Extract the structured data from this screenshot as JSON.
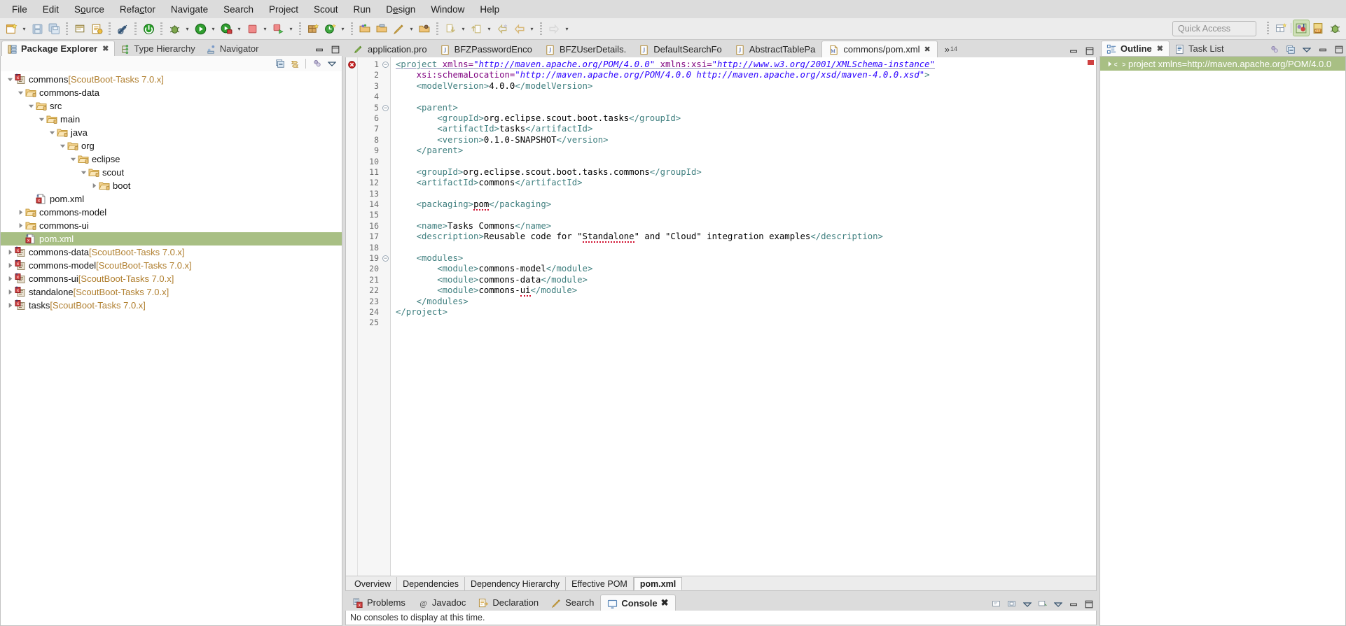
{
  "menubar": {
    "items": [
      {
        "label": "File"
      },
      {
        "label": "Edit"
      },
      {
        "label": "Source"
      },
      {
        "label": "Refactor"
      },
      {
        "label": "Navigate"
      },
      {
        "label": "Search"
      },
      {
        "label": "Project"
      },
      {
        "label": "Scout"
      },
      {
        "label": "Run"
      },
      {
        "label": "Design"
      },
      {
        "label": "Window"
      },
      {
        "label": "Help"
      }
    ]
  },
  "toolbar": {
    "quick_access_placeholder": "Quick Access",
    "buttons": [
      {
        "name": "new-wizard",
        "icon": "new-file-icon"
      },
      {
        "name": "save",
        "icon": "save-icon"
      },
      {
        "name": "save-all",
        "icon": "save-all-icon"
      },
      {
        "name": "print",
        "icon": "print-icon"
      },
      {
        "name": "new-java-package",
        "icon": "package-icon"
      },
      {
        "name": "toggle-mark-occurrences",
        "icon": "mark-occurrences-icon"
      },
      {
        "name": "skip-breakpoints",
        "icon": "skip-breakpoints-icon"
      },
      {
        "name": "debug",
        "icon": "debug-icon"
      },
      {
        "name": "run",
        "icon": "run-icon"
      },
      {
        "name": "coverage",
        "icon": "coverage-icon"
      },
      {
        "name": "terminate",
        "icon": "terminate-icon"
      },
      {
        "name": "run-external-tools",
        "icon": "external-tools-icon"
      },
      {
        "name": "new-scout-project",
        "icon": "scout-project-icon"
      },
      {
        "name": "new-scout-element",
        "icon": "scout-element-icon"
      },
      {
        "name": "open-type",
        "icon": "open-type-icon"
      },
      {
        "name": "open-task",
        "icon": "open-task-icon"
      },
      {
        "name": "search",
        "icon": "search-pen-icon"
      },
      {
        "name": "open-resource",
        "icon": "open-resource-icon"
      },
      {
        "name": "next-annotation",
        "icon": "next-annotation-icon"
      },
      {
        "name": "previous-annotation",
        "icon": "previous-annotation-icon"
      },
      {
        "name": "last-edit-location",
        "icon": "last-edit-icon"
      },
      {
        "name": "back",
        "icon": "back-arrow-icon"
      },
      {
        "name": "forward",
        "icon": "forward-arrow-icon"
      },
      {
        "name": "pin-editor",
        "icon": "pin-icon"
      }
    ],
    "right_buttons": [
      {
        "name": "open-perspective",
        "icon": "open-perspective-icon"
      },
      {
        "name": "perspective-java-ee",
        "icon": "java-ee-perspective-icon",
        "active": true
      },
      {
        "name": "perspective-git",
        "icon": "git-perspective-icon"
      },
      {
        "name": "perspective-debug",
        "icon": "debug-perspective-icon"
      }
    ]
  },
  "package_explorer": {
    "tabs": [
      {
        "label": "Package Explorer",
        "icon": "package-explorer-icon",
        "active": true,
        "closeable": true
      },
      {
        "label": "Type Hierarchy",
        "icon": "type-hierarchy-icon",
        "active": false,
        "closeable": false
      },
      {
        "label": "Navigator",
        "icon": "navigator-icon",
        "active": false,
        "closeable": false
      }
    ],
    "view_toolbar": [
      {
        "name": "collapse-all",
        "icon": "collapse-all-icon"
      },
      {
        "name": "link-with-editor",
        "icon": "link-editor-icon"
      },
      {
        "name": "focus-on-active-task",
        "icon": "focus-task-icon"
      },
      {
        "name": "view-menu",
        "icon": "view-menu-icon"
      }
    ],
    "tree": [
      {
        "depth": 0,
        "twist": "down",
        "icon": "maven-project-icon",
        "label": "commons",
        "suffix": " [ScoutBoot-Tasks 7.0.x]",
        "selected": false
      },
      {
        "depth": 1,
        "twist": "down",
        "icon": "folder-icon",
        "label": "commons-data",
        "suffix": "",
        "selected": false
      },
      {
        "depth": 2,
        "twist": "down",
        "icon": "folder-icon",
        "label": "src",
        "suffix": "",
        "selected": false
      },
      {
        "depth": 3,
        "twist": "down",
        "icon": "folder-icon",
        "label": "main",
        "suffix": "",
        "selected": false
      },
      {
        "depth": 4,
        "twist": "down",
        "icon": "folder-icon",
        "label": "java",
        "suffix": "",
        "selected": false
      },
      {
        "depth": 5,
        "twist": "down",
        "icon": "folder-icon",
        "label": "org",
        "suffix": "",
        "selected": false
      },
      {
        "depth": 6,
        "twist": "down",
        "icon": "folder-icon",
        "label": "eclipse",
        "suffix": "",
        "selected": false
      },
      {
        "depth": 7,
        "twist": "down",
        "icon": "folder-icon",
        "label": "scout",
        "suffix": "",
        "selected": false
      },
      {
        "depth": 8,
        "twist": "right",
        "icon": "folder-icon",
        "label": "boot",
        "suffix": "",
        "selected": false
      },
      {
        "depth": 2,
        "twist": "none",
        "icon": "pom-file-icon",
        "label": "pom.xml",
        "suffix": "",
        "selected": false
      },
      {
        "depth": 1,
        "twist": "right",
        "icon": "folder-icon",
        "label": "commons-model",
        "suffix": "",
        "selected": false
      },
      {
        "depth": 1,
        "twist": "right",
        "icon": "folder-icon",
        "label": "commons-ui",
        "suffix": "",
        "selected": false
      },
      {
        "depth": 1,
        "twist": "none",
        "icon": "pom-file-icon",
        "label": "pom.xml",
        "suffix": "",
        "selected": true
      },
      {
        "depth": 0,
        "twist": "right",
        "icon": "maven-project-icon",
        "label": "commons-data",
        "suffix": " [ScoutBoot-Tasks 7.0.x]",
        "selected": false
      },
      {
        "depth": 0,
        "twist": "right",
        "icon": "maven-project-icon",
        "label": "commons-model",
        "suffix": " [ScoutBoot-Tasks 7.0.x]",
        "selected": false
      },
      {
        "depth": 0,
        "twist": "right",
        "icon": "maven-project-icon",
        "label": "commons-ui",
        "suffix": " [ScoutBoot-Tasks 7.0.x]",
        "selected": false
      },
      {
        "depth": 0,
        "twist": "right",
        "icon": "maven-project-icon",
        "label": "standalone",
        "suffix": " [ScoutBoot-Tasks 7.0.x]",
        "selected": false
      },
      {
        "depth": 0,
        "twist": "right",
        "icon": "maven-project-icon",
        "label": "tasks",
        "suffix": " [ScoutBoot-Tasks 7.0.x]",
        "selected": false
      }
    ]
  },
  "editor": {
    "tabs": [
      {
        "label": "application.pro",
        "icon": "properties-file-icon",
        "active": false
      },
      {
        "label": "BFZPasswordEnco",
        "icon": "java-file-icon",
        "active": false
      },
      {
        "label": "BFZUserDetails.",
        "icon": "java-file-icon",
        "active": false
      },
      {
        "label": "DefaultSearchFo",
        "icon": "java-file-icon",
        "active": false
      },
      {
        "label": "AbstractTablePa",
        "icon": "java-file-icon",
        "active": false
      },
      {
        "label": "commons/pom.xml",
        "icon": "maven-file-icon",
        "active": true
      }
    ],
    "hidden_tabs_count": "14",
    "hidden_tabs_chevron": "»",
    "lines": [
      {
        "num": "1",
        "fold": "minus",
        "error": true,
        "segments": [
          {
            "t": "<project ",
            "c": "tag"
          },
          {
            "t": "xmlns=",
            "c": "attn"
          },
          {
            "t": "\"http://maven.apache.org/POM/4.0.0\"",
            "c": "attv"
          },
          {
            "t": " ",
            "c": "txt"
          },
          {
            "t": "xmlns:xsi=",
            "c": "attn"
          },
          {
            "t": "\"http://www.w3.org/2001/XMLSchema-instance\"",
            "c": "attv"
          }
        ]
      },
      {
        "num": "2",
        "fold": "",
        "error": false,
        "segments": [
          {
            "t": "    ",
            "c": "txt"
          },
          {
            "t": "xsi:schemaLocation=",
            "c": "attn"
          },
          {
            "t": "\"http://maven.apache.org/POM/4.0.0 http://maven.apache.org/xsd/maven-4.0.0.xsd\"",
            "c": "attv"
          },
          {
            "t": ">",
            "c": "tag"
          }
        ]
      },
      {
        "num": "3",
        "fold": "",
        "error": false,
        "segments": [
          {
            "t": "    ",
            "c": "txt"
          },
          {
            "t": "<modelVersion>",
            "c": "tag"
          },
          {
            "t": "4.0.0",
            "c": "txt"
          },
          {
            "t": "</modelVersion>",
            "c": "tag"
          }
        ]
      },
      {
        "num": "4",
        "fold": "",
        "error": false,
        "segments": []
      },
      {
        "num": "5",
        "fold": "minus",
        "error": false,
        "segments": [
          {
            "t": "    ",
            "c": "txt"
          },
          {
            "t": "<parent>",
            "c": "tag"
          }
        ]
      },
      {
        "num": "6",
        "fold": "",
        "error": false,
        "segments": [
          {
            "t": "        ",
            "c": "txt"
          },
          {
            "t": "<groupId>",
            "c": "tag"
          },
          {
            "t": "org.eclipse.scout.boot.tasks",
            "c": "txt"
          },
          {
            "t": "</groupId>",
            "c": "tag"
          }
        ]
      },
      {
        "num": "7",
        "fold": "",
        "error": false,
        "segments": [
          {
            "t": "        ",
            "c": "txt"
          },
          {
            "t": "<artifactId>",
            "c": "tag"
          },
          {
            "t": "tasks",
            "c": "txt"
          },
          {
            "t": "</artifactId>",
            "c": "tag"
          }
        ]
      },
      {
        "num": "8",
        "fold": "",
        "error": false,
        "segments": [
          {
            "t": "        ",
            "c": "txt"
          },
          {
            "t": "<version>",
            "c": "tag"
          },
          {
            "t": "0.1.0-SNAPSHOT",
            "c": "txt"
          },
          {
            "t": "</version>",
            "c": "tag"
          }
        ]
      },
      {
        "num": "9",
        "fold": "",
        "error": false,
        "segments": [
          {
            "t": "    ",
            "c": "txt"
          },
          {
            "t": "</parent>",
            "c": "tag"
          }
        ]
      },
      {
        "num": "10",
        "fold": "",
        "error": false,
        "segments": []
      },
      {
        "num": "11",
        "fold": "",
        "error": false,
        "segments": [
          {
            "t": "    ",
            "c": "txt"
          },
          {
            "t": "<groupId>",
            "c": "tag"
          },
          {
            "t": "org.eclipse.scout.boot.tasks.commons",
            "c": "txt"
          },
          {
            "t": "</groupId>",
            "c": "tag"
          }
        ]
      },
      {
        "num": "12",
        "fold": "",
        "error": false,
        "segments": [
          {
            "t": "    ",
            "c": "txt"
          },
          {
            "t": "<artifactId>",
            "c": "tag"
          },
          {
            "t": "commons",
            "c": "txt"
          },
          {
            "t": "</artifactId>",
            "c": "tag"
          }
        ]
      },
      {
        "num": "13",
        "fold": "",
        "error": false,
        "segments": []
      },
      {
        "num": "14",
        "fold": "",
        "error": false,
        "segments": [
          {
            "t": "    ",
            "c": "txt"
          },
          {
            "t": "<packaging>",
            "c": "tag"
          },
          {
            "t": "pom",
            "c": "squig"
          },
          {
            "t": "</packaging>",
            "c": "tag"
          }
        ]
      },
      {
        "num": "15",
        "fold": "",
        "error": false,
        "segments": []
      },
      {
        "num": "16",
        "fold": "",
        "error": false,
        "segments": [
          {
            "t": "    ",
            "c": "txt"
          },
          {
            "t": "<name>",
            "c": "tag"
          },
          {
            "t": "Tasks Commons",
            "c": "txt"
          },
          {
            "t": "</name>",
            "c": "tag"
          }
        ]
      },
      {
        "num": "17",
        "fold": "",
        "error": false,
        "segments": [
          {
            "t": "    ",
            "c": "txt"
          },
          {
            "t": "<description>",
            "c": "tag"
          },
          {
            "t": "Reusable code for \"",
            "c": "txt"
          },
          {
            "t": "Standalone",
            "c": "squig"
          },
          {
            "t": "\" and \"Cloud\" integration examples",
            "c": "txt"
          },
          {
            "t": "</description>",
            "c": "tag"
          }
        ]
      },
      {
        "num": "18",
        "fold": "",
        "error": false,
        "segments": []
      },
      {
        "num": "19",
        "fold": "minus",
        "error": false,
        "segments": [
          {
            "t": "    ",
            "c": "txt"
          },
          {
            "t": "<modules>",
            "c": "tag"
          }
        ]
      },
      {
        "num": "20",
        "fold": "",
        "error": false,
        "segments": [
          {
            "t": "        ",
            "c": "txt"
          },
          {
            "t": "<module>",
            "c": "tag"
          },
          {
            "t": "commons-model",
            "c": "txt"
          },
          {
            "t": "</module>",
            "c": "tag"
          }
        ]
      },
      {
        "num": "21",
        "fold": "",
        "error": false,
        "segments": [
          {
            "t": "        ",
            "c": "txt"
          },
          {
            "t": "<module>",
            "c": "tag"
          },
          {
            "t": "commons-data",
            "c": "txt"
          },
          {
            "t": "</module>",
            "c": "tag"
          }
        ]
      },
      {
        "num": "22",
        "fold": "",
        "error": false,
        "segments": [
          {
            "t": "        ",
            "c": "txt"
          },
          {
            "t": "<module>",
            "c": "tag"
          },
          {
            "t": "commons-",
            "c": "txt"
          },
          {
            "t": "ui",
            "c": "squig"
          },
          {
            "t": "</module>",
            "c": "tag"
          }
        ]
      },
      {
        "num": "23",
        "fold": "",
        "error": false,
        "segments": [
          {
            "t": "    ",
            "c": "txt"
          },
          {
            "t": "</modules>",
            "c": "tag"
          }
        ]
      },
      {
        "num": "24",
        "fold": "",
        "error": false,
        "segments": [
          {
            "t": "</project>",
            "c": "tag"
          }
        ]
      },
      {
        "num": "25",
        "fold": "",
        "error": false,
        "segments": []
      }
    ],
    "form_tabs": [
      {
        "label": "Overview",
        "active": false
      },
      {
        "label": "Dependencies",
        "active": false
      },
      {
        "label": "Dependency Hierarchy",
        "active": false
      },
      {
        "label": "Effective POM",
        "active": false
      },
      {
        "label": "pom.xml",
        "active": true
      }
    ]
  },
  "outline": {
    "tabs": [
      {
        "label": "Outline",
        "icon": "outline-icon",
        "active": true,
        "closeable": true
      },
      {
        "label": "Task List",
        "icon": "task-list-icon",
        "active": false,
        "closeable": false
      }
    ],
    "view_toolbar": [
      {
        "name": "focus-on-active-task",
        "icon": "focus-task-icon"
      },
      {
        "name": "collapse-all",
        "icon": "collapse-all-icon"
      },
      {
        "name": "view-menu",
        "icon": "view-menu-icon"
      },
      {
        "name": "minimize",
        "icon": "minimize-icon"
      },
      {
        "name": "maximize",
        "icon": "maximize-icon"
      }
    ],
    "tree": [
      {
        "twist": "right",
        "icon": "xml-element-icon",
        "label": "project xmlns=http://maven.apache.org/POM/4.0.0",
        "selected": true
      }
    ]
  },
  "bottom_panel": {
    "tabs": [
      {
        "label": "Problems",
        "icon": "problems-icon",
        "active": false,
        "closeable": false
      },
      {
        "label": "Javadoc",
        "icon": "javadoc-icon",
        "active": false,
        "closeable": false
      },
      {
        "label": "Declaration",
        "icon": "declaration-icon",
        "active": false,
        "closeable": false
      },
      {
        "label": "Search",
        "icon": "search-icon",
        "active": false,
        "closeable": false
      },
      {
        "label": "Console",
        "icon": "console-icon",
        "active": true,
        "closeable": true
      }
    ],
    "content": "No consoles to display at this time.",
    "view_toolbar": [
      {
        "name": "open-console",
        "icon": "open-console-icon"
      },
      {
        "name": "display-selected-console",
        "icon": "display-console-icon"
      },
      {
        "name": "pin-console",
        "icon": "pin-console-icon"
      },
      {
        "name": "new-console-view",
        "icon": "new-console-icon"
      },
      {
        "name": "view-menu",
        "icon": "view-menu-icon"
      },
      {
        "name": "minimize",
        "icon": "minimize-icon"
      },
      {
        "name": "maximize",
        "icon": "maximize-icon"
      }
    ]
  },
  "colors": {
    "selection_green": "#a8bf84",
    "tag": "#3f7f7f",
    "attr_name": "#7f007f",
    "attr_value": "#2a00ff",
    "error_red": "#c00000",
    "suffix_brown": "#b07f2f"
  }
}
